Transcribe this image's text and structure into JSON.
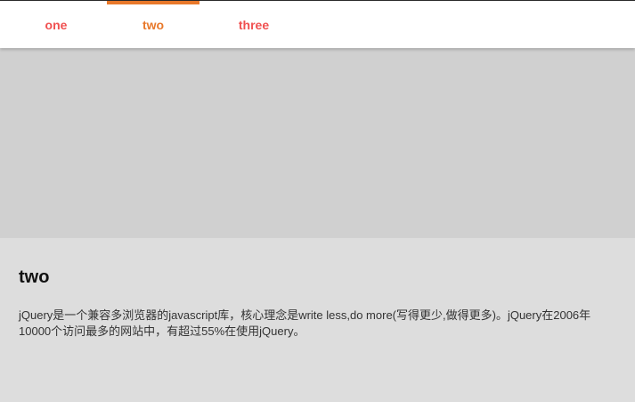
{
  "tabs": [
    {
      "label": "one",
      "active": false
    },
    {
      "label": "two",
      "active": true
    },
    {
      "label": "three",
      "active": false
    }
  ],
  "colors": {
    "tab_text": "#f05050",
    "tab_active": "#e8782a",
    "hero_background": "#d0d0d0",
    "content_background": "#dddddd"
  },
  "content": {
    "title": "two",
    "body_lines": [
      "jQuery是一个兼容多浏览器的javascript库，核心理念是write less,do more(写得更少,做得更多)。jQuery在2006年",
      "10000个访问最多的网站中，有超过55%在使用jQuery。"
    ]
  }
}
